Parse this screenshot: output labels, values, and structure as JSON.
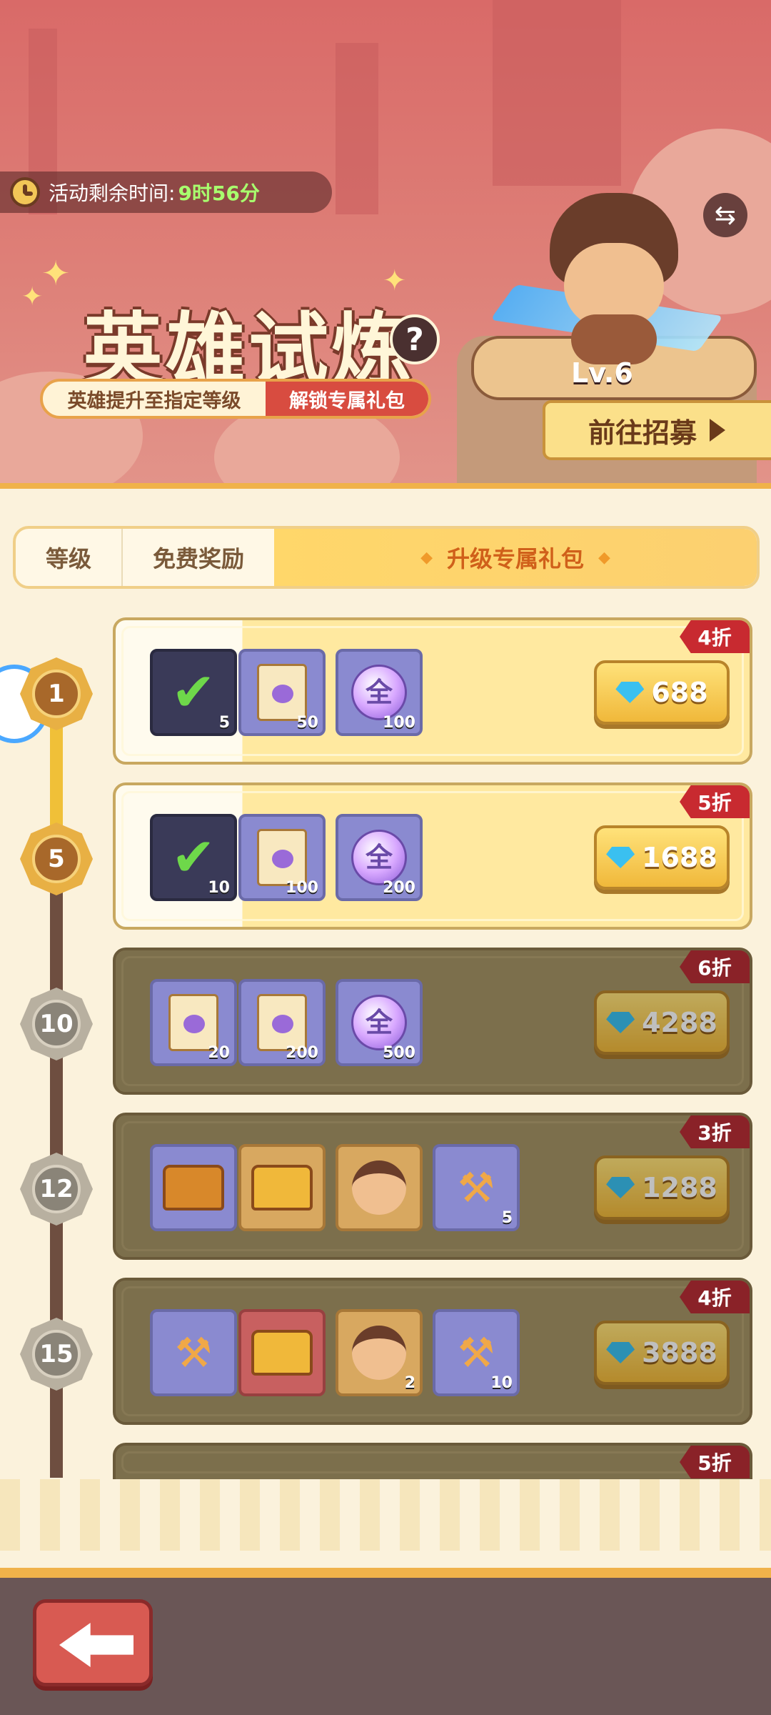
{
  "header": {
    "timer_label": "活动剩余时间:",
    "timer_value": "9时56分",
    "title": "英雄试炼",
    "help_icon": "question-icon",
    "subtitle_left": "英雄提升至指定等级",
    "subtitle_right": "解锁专属礼包",
    "hero_level": "Lv.6",
    "recruit_label": "前往招募",
    "swap_icon": "swap-icon"
  },
  "tabs": [
    {
      "label": "等级"
    },
    {
      "label": "免费奖励"
    },
    {
      "label": "升级专属礼包",
      "active": true
    }
  ],
  "tiers": [
    {
      "level": "1",
      "unlocked": true,
      "discount": "4折",
      "price": "688",
      "items": [
        {
          "icon": "integral-scroll-check-icon",
          "qty": "5"
        },
        {
          "icon": "integral-scroll-icon",
          "qty": "50"
        },
        {
          "icon": "all-orb-icon",
          "label": "全",
          "qty": "100"
        }
      ]
    },
    {
      "level": "5",
      "unlocked": true,
      "discount": "5折",
      "price": "1688",
      "items": [
        {
          "icon": "integral-scroll-check-icon",
          "qty": "10"
        },
        {
          "icon": "integral-scroll-icon",
          "qty": "100"
        },
        {
          "icon": "all-orb-icon",
          "label": "全",
          "qty": "200"
        }
      ]
    },
    {
      "level": "10",
      "unlocked": false,
      "discount": "6折",
      "price": "4288",
      "items": [
        {
          "icon": "integral-scroll-icon",
          "qty": "20"
        },
        {
          "icon": "integral-scroll-icon",
          "qty": "200"
        },
        {
          "icon": "all-orb-icon",
          "label": "全",
          "qty": "500"
        }
      ]
    },
    {
      "level": "12",
      "unlocked": false,
      "discount": "3折",
      "price": "1288",
      "items": [
        {
          "icon": "treasure-chest-icon",
          "qty": ""
        },
        {
          "icon": "mystery-chest-icon",
          "qty": ""
        },
        {
          "icon": "hero-portrait-icon",
          "qty": ""
        },
        {
          "icon": "hammer-icon",
          "qty": "5"
        }
      ]
    },
    {
      "level": "15",
      "unlocked": false,
      "discount": "4折",
      "price": "3888",
      "items": [
        {
          "icon": "hammer-icon",
          "qty": ""
        },
        {
          "icon": "mystery-chest-icon",
          "qty": ""
        },
        {
          "icon": "hero-portrait-icon",
          "qty": "2"
        },
        {
          "icon": "hammer-icon",
          "qty": "10"
        }
      ]
    },
    {
      "level": "",
      "unlocked": false,
      "discount": "5折",
      "price": "",
      "items": []
    }
  ],
  "footer": {
    "back_icon": "back-arrow-icon"
  },
  "colors": {
    "accent": "#f0b24a",
    "discount": "#c82a30",
    "active_tab_text": "#d0601a"
  }
}
